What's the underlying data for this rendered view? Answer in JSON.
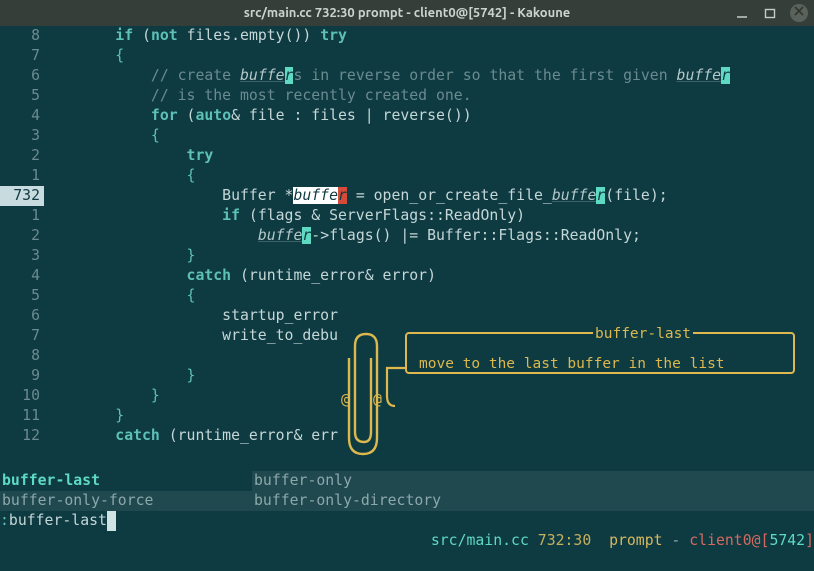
{
  "window": {
    "title": "src/main.cc 732:30  prompt - client0@[5742] - Kakoune"
  },
  "gutter": [
    "8",
    "7",
    "6",
    "5",
    "4",
    "3",
    "2",
    "1",
    "732",
    "1",
    "2",
    "3",
    "4",
    "5",
    "6",
    "7",
    "8",
    "9",
    "10",
    "11",
    "12"
  ],
  "code": {
    "l0": {
      "indent": "        ",
      "kw1": "if",
      "paren": " (",
      "kw2": "not",
      "rest": " files.empty()) ",
      "kw3": "try"
    },
    "l1": {
      "indent": "        ",
      "brace": "{"
    },
    "l2": {
      "indent": "            ",
      "c1": "// create ",
      "h1": "buffe",
      "hc": "r",
      "c2": "s in reverse order so that the first given ",
      "h2": "buffe",
      "hc2": "r"
    },
    "l3": {
      "indent": "            ",
      "c": "// is the most recently created one."
    },
    "l4": {
      "indent": "            ",
      "kw1": "for",
      "paren": " (",
      "kw2": "auto",
      "amp": "& file : files | reverse())"
    },
    "l5": {
      "indent": "            ",
      "brace": "{"
    },
    "l6": {
      "indent": "                ",
      "kw": "try"
    },
    "l7": {
      "indent": "                ",
      "brace": "{"
    },
    "l8": {
      "indent": "                    ",
      "t": "Buffer *",
      "sel": "buffe",
      "selr": "r",
      "rest": " = open_or_create_file_",
      "h": "buffe",
      "hc": "r",
      "tail": "(file);"
    },
    "l9": {
      "indent": "                    ",
      "kw": "if",
      "rest": " (flags & ServerFlags::ReadOnly)"
    },
    "l10": {
      "indent": "                        ",
      "h": "buffe",
      "hc": "r",
      "rest": "->flags() |= Buffer::Flags::ReadOnly;"
    },
    "l11": {
      "indent": "                ",
      "brace": "}"
    },
    "l12": {
      "indent": "                ",
      "kw": "catch",
      "rest": " (runtime_error& error)"
    },
    "l13": {
      "indent": "                ",
      "brace": "{"
    },
    "l14": {
      "indent": "                    ",
      "t": "startup_error"
    },
    "l15": {
      "indent": "                    ",
      "t": "write_to_debu"
    },
    "l16_blank": "",
    "l17": {
      "indent": "                ",
      "brace": "}"
    },
    "l18": {
      "indent": "            ",
      "brace": "}"
    },
    "l19": {
      "indent": "        ",
      "brace": "}"
    },
    "l20": {
      "indent": "        ",
      "kw": "catch",
      "rest": " (runtime_error& err"
    }
  },
  "completions": {
    "rows": [
      [
        "buffer-last",
        "buffer-only"
      ],
      [
        "buffer-only-force",
        "buffer-only-directory"
      ]
    ],
    "selected": [
      0,
      0
    ]
  },
  "prompt": {
    "prefix": ":",
    "typed": "buffer-last"
  },
  "status": {
    "file": "src/main.cc",
    "pos": "732:30",
    "mode": "prompt",
    "dash": " - ",
    "user": "client0@[",
    "sess": "5742",
    "tail": "]"
  },
  "clippy": {
    "title": "buffer-last",
    "body": "move to the last buffer in the list"
  }
}
